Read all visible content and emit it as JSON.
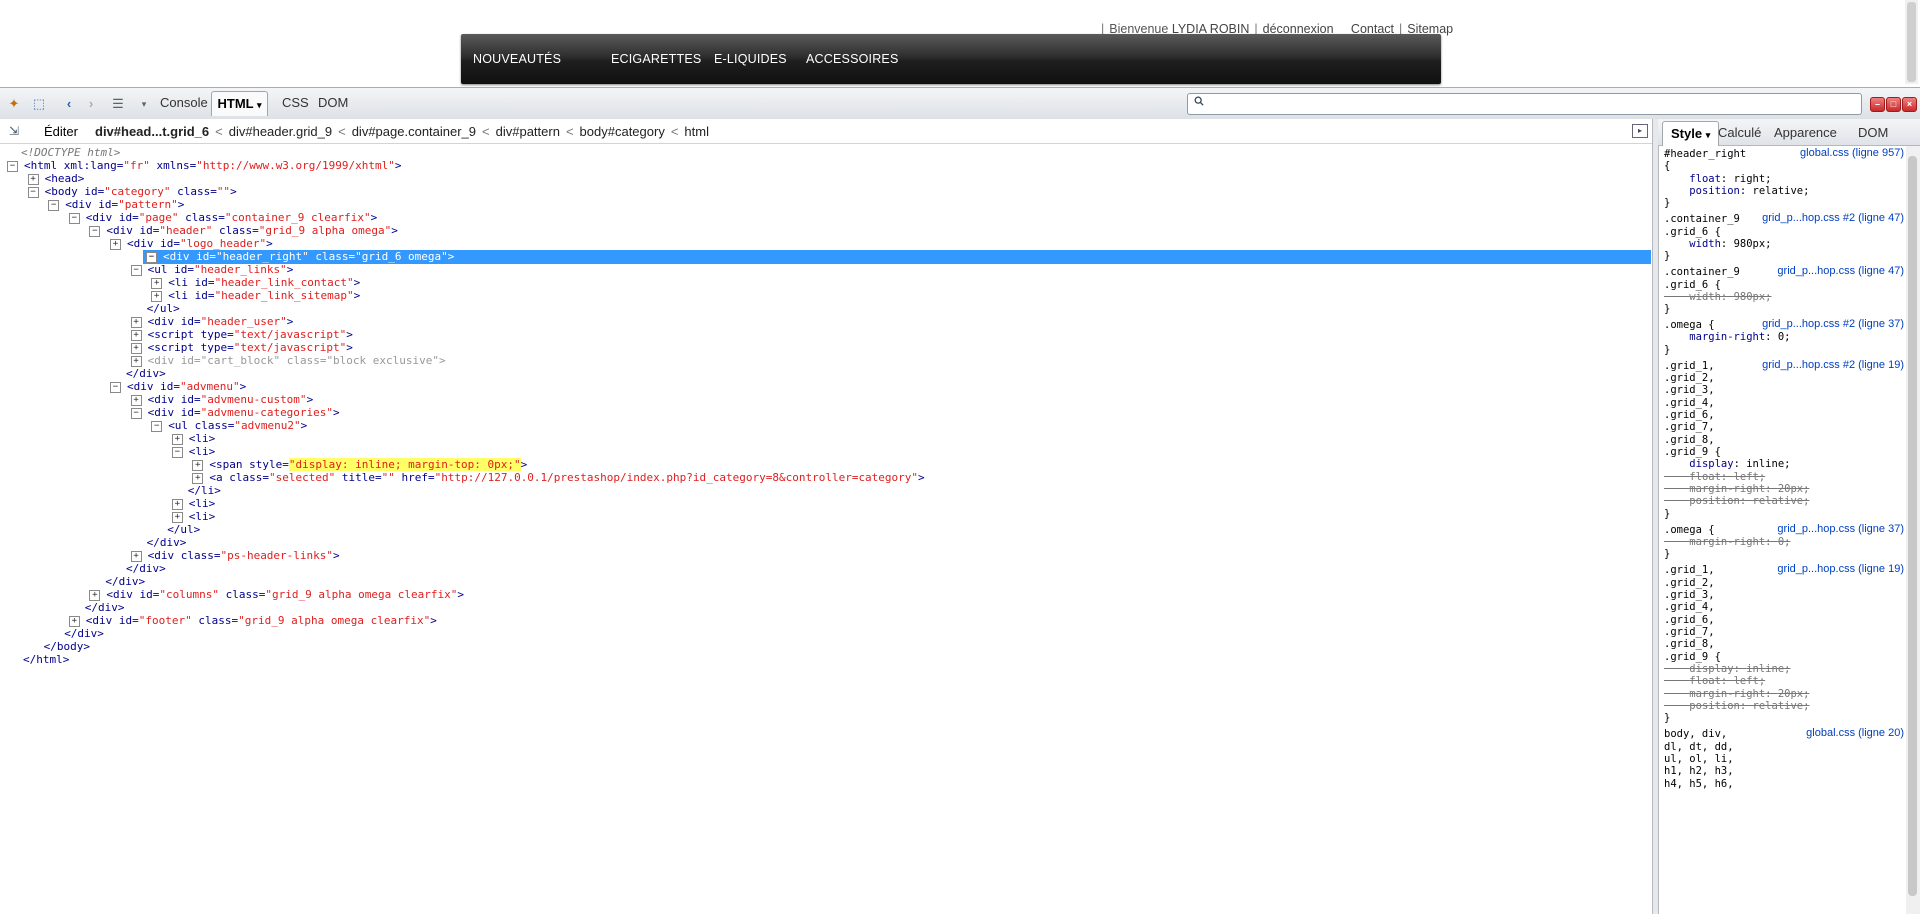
{
  "site": {
    "user_bar": {
      "welcome": "Bienvenue",
      "user": "LYDIA ROBIN",
      "logout": "déconnexion",
      "contact": "Contact",
      "sitemap": "Sitemap"
    },
    "menu": [
      "NOUVEAUTÉS",
      "ECIGARETTES",
      "E-LIQUIDES",
      "ACCESSOIRES"
    ]
  },
  "toolbar": {
    "tabs": {
      "console": "Console",
      "html": "HTML",
      "css": "CSS",
      "dom": "DOM"
    },
    "search_value": ""
  },
  "breadcrumb": {
    "edit": "Éditer",
    "items": [
      "div#head...t.grid_6",
      "div#header.grid_9",
      "div#page.container_9",
      "div#pattern",
      "body#category",
      "html"
    ]
  },
  "tree": [
    {
      "t": "doctype",
      "text": "<!DOCTYPE html>"
    },
    {
      "t": "open",
      "tw": "-",
      "tag": "html",
      "attrs": [
        [
          "xml:lang",
          "fr"
        ],
        [
          "xmlns",
          "http://www.w3.org/1999/xhtml"
        ]
      ]
    },
    {
      "t": "open",
      "tw": "+",
      "tag": "head",
      "attrs": []
    },
    {
      "t": "open",
      "tw": "-",
      "tag": "body",
      "attrs": [
        [
          "id",
          "category"
        ],
        [
          "class",
          ""
        ]
      ]
    },
    {
      "t": "open",
      "tw": "-",
      "tag": "div",
      "attrs": [
        [
          "id",
          "pattern"
        ]
      ]
    },
    {
      "t": "open",
      "tw": "-",
      "tag": "div",
      "attrs": [
        [
          "id",
          "page"
        ],
        [
          "class",
          "container_9 clearfix"
        ]
      ]
    },
    {
      "t": "open",
      "tw": "-",
      "tag": "div",
      "attrs": [
        [
          "id",
          "header"
        ],
        [
          "class",
          "grid_9 alpha omega"
        ]
      ]
    },
    {
      "t": "open",
      "tw": "+",
      "tag": "div",
      "attrs": [
        [
          "id",
          "logo_header"
        ]
      ]
    },
    {
      "t": "open",
      "tw": "-",
      "tag": "div",
      "attrs": [
        [
          "id",
          "header_right"
        ],
        [
          "class",
          "grid_6 omega"
        ]
      ],
      "sel": true
    },
    {
      "t": "open",
      "tw": "-",
      "tag": "ul",
      "attrs": [
        [
          "id",
          "header_links"
        ]
      ]
    },
    {
      "t": "open",
      "tw": "+",
      "tag": "li",
      "attrs": [
        [
          "id",
          "header_link_contact"
        ]
      ]
    },
    {
      "t": "open",
      "tw": "+",
      "tag": "li",
      "attrs": [
        [
          "id",
          "header_link_sitemap"
        ]
      ]
    },
    {
      "t": "close",
      "tag": "ul"
    },
    {
      "t": "open",
      "tw": "+",
      "tag": "div",
      "attrs": [
        [
          "id",
          "header_user"
        ]
      ]
    },
    {
      "t": "open",
      "tw": "+",
      "tag": "script",
      "attrs": [
        [
          "type",
          "text/javascript"
        ]
      ]
    },
    {
      "t": "open",
      "tw": "+",
      "tag": "script",
      "attrs": [
        [
          "type",
          "text/javascript"
        ]
      ]
    },
    {
      "t": "open",
      "tw": "+",
      "tag": "div",
      "attrs": [
        [
          "id",
          "cart_block"
        ],
        [
          "class",
          "block exclusive"
        ]
      ],
      "dim": true
    },
    {
      "t": "close",
      "tag": "div"
    },
    {
      "t": "open",
      "tw": "-",
      "tag": "div",
      "attrs": [
        [
          "id",
          "advmenu"
        ]
      ]
    },
    {
      "t": "open",
      "tw": "+",
      "tag": "div",
      "attrs": [
        [
          "id",
          "advmenu-custom"
        ]
      ]
    },
    {
      "t": "open",
      "tw": "-",
      "tag": "div",
      "attrs": [
        [
          "id",
          "advmenu-categories"
        ]
      ]
    },
    {
      "t": "open",
      "tw": "-",
      "tag": "ul",
      "attrs": [
        [
          "class",
          "advmenu2"
        ]
      ]
    },
    {
      "t": "open",
      "tw": "+",
      "tag": "li",
      "attrs": []
    },
    {
      "t": "open",
      "tw": "-",
      "tag": "li",
      "attrs": []
    },
    {
      "t": "open",
      "tw": "+",
      "tag": "span",
      "attrs": [
        [
          "style",
          "display: inline; margin-top: 0px;"
        ]
      ],
      "hl": true
    },
    {
      "t": "open",
      "tw": "+",
      "tag": "a",
      "attrs": [
        [
          "class",
          "selected"
        ],
        [
          "title",
          ""
        ],
        [
          "href",
          "http://127.0.0.1/prestashop/index.php?id_category=8&controller=category"
        ]
      ]
    },
    {
      "t": "close",
      "tag": "li"
    },
    {
      "t": "open",
      "tw": "+",
      "tag": "li",
      "attrs": []
    },
    {
      "t": "open",
      "tw": "+",
      "tag": "li",
      "attrs": []
    },
    {
      "t": "close",
      "tag": "ul"
    },
    {
      "t": "close",
      "tag": "div"
    },
    {
      "t": "open",
      "tw": "+",
      "tag": "div",
      "attrs": [
        [
          "class",
          "ps-header-links"
        ]
      ]
    },
    {
      "t": "close",
      "tag": "div"
    },
    {
      "t": "close",
      "tag": "div"
    },
    {
      "t": "open",
      "tw": "+",
      "tag": "div",
      "attrs": [
        [
          "id",
          "columns"
        ],
        [
          "class",
          "grid_9 alpha omega clearfix"
        ]
      ]
    },
    {
      "t": "close",
      "tag": "div"
    },
    {
      "t": "open",
      "tw": "+",
      "tag": "div",
      "attrs": [
        [
          "id",
          "footer"
        ],
        [
          "class",
          "grid_9 alpha omega clearfix"
        ]
      ]
    },
    {
      "t": "close",
      "tag": "div"
    },
    {
      "t": "close",
      "tag": "body"
    },
    {
      "t": "close",
      "tag": "html"
    }
  ],
  "side": {
    "tabs": {
      "style": "Style",
      "computed": "Calculé",
      "layout": "Apparence",
      "dom": "DOM"
    },
    "rules": [
      {
        "src": "global.css (ligne 957)",
        "lines": [
          {
            "s": "#header_right"
          },
          {
            "s": "{"
          },
          {
            "p": "float",
            "v": "right;"
          },
          {
            "p": "position",
            "v": "relative;"
          },
          {
            "s": "}"
          }
        ]
      },
      {
        "src": "grid_p...hop.css #2 (ligne 47)",
        "lines": [
          {
            "s": ".container_9"
          },
          {
            "s": ".grid_6 {"
          },
          {
            "p": "width",
            "v": "980px;"
          },
          {
            "s": "}"
          }
        ]
      },
      {
        "src": "grid_p...hop.css (ligne 47)",
        "lines": [
          {
            "s": ".container_9"
          },
          {
            "s": ".grid_6 {"
          },
          {
            "p": "width",
            "v": "980px;",
            "o": true
          },
          {
            "s": "}"
          }
        ]
      },
      {
        "src": "grid_p...hop.css #2 (ligne 37)",
        "lines": [
          {
            "s": ".omega {"
          },
          {
            "p": "margin-right",
            "v": "0;"
          },
          {
            "s": "}"
          }
        ]
      },
      {
        "src": "grid_p...hop.css #2 (ligne 19)",
        "lines": [
          {
            "s": ".grid_1,"
          },
          {
            "s": ".grid_2,"
          },
          {
            "s": ".grid_3,"
          },
          {
            "s": ".grid_4,"
          },
          {
            "s": ".grid_6,"
          },
          {
            "s": ".grid_7,"
          },
          {
            "s": ".grid_8,"
          },
          {
            "s": ".grid_9 {"
          },
          {
            "p": "display",
            "v": "inline;"
          },
          {
            "p": "float",
            "v": "left;",
            "o": true
          },
          {
            "p": "margin-right",
            "v": "20px;",
            "o": true
          },
          {
            "p": "position",
            "v": "relative;",
            "o": true
          },
          {
            "s": "}"
          }
        ]
      },
      {
        "src": "grid_p...hop.css (ligne 37)",
        "lines": [
          {
            "s": ".omega {"
          },
          {
            "p": "margin-right",
            "v": "0;",
            "o": true
          },
          {
            "s": "}"
          }
        ]
      },
      {
        "src": "grid_p...hop.css (ligne 19)",
        "lines": [
          {
            "s": ".grid_1,"
          },
          {
            "s": ".grid_2,"
          },
          {
            "s": ".grid_3,"
          },
          {
            "s": ".grid_4,"
          },
          {
            "s": ".grid_6,"
          },
          {
            "s": ".grid_7,"
          },
          {
            "s": ".grid_8,"
          },
          {
            "s": ".grid_9 {"
          },
          {
            "p": "display",
            "v": "inline;",
            "o": true
          },
          {
            "p": "float",
            "v": "left;",
            "o": true
          },
          {
            "p": "margin-right",
            "v": "20px;",
            "o": true
          },
          {
            "p": "position",
            "v": "relative;",
            "o": true
          },
          {
            "s": "}"
          }
        ]
      },
      {
        "src": "global.css (ligne 20)",
        "lines": [
          {
            "s": "body, div,"
          },
          {
            "s": "dl, dt, dd,"
          },
          {
            "s": "ul, ol, li,"
          },
          {
            "s": "h1, h2, h3,"
          },
          {
            "s": "h4, h5, h6,"
          }
        ]
      }
    ]
  },
  "colors": {
    "selection": "#3399ff",
    "attr_value": "#e01e1e",
    "tag": "#00008b",
    "source_link": "#0040c0"
  }
}
